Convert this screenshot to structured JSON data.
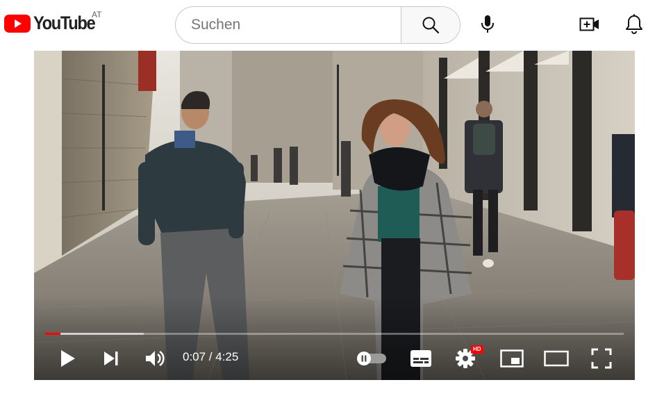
{
  "masthead": {
    "logo_text": "YouTube",
    "region_code": "AT",
    "search_placeholder": "Suchen",
    "search_value": "",
    "icons": [
      "search-icon",
      "mic-icon",
      "create-video-icon",
      "notifications-bell-icon"
    ]
  },
  "player": {
    "current_time": "0:07",
    "duration": "4:25",
    "time_display": "0:07 / 4:25",
    "progress_fraction": 0.027,
    "buffered_fraction": 0.17,
    "quality_badge": "HD",
    "autoplay_on": false,
    "colors": {
      "played": "#ff0000",
      "logo": "#ff0000",
      "badge": "#ff0000"
    },
    "icons": [
      "play-icon",
      "next-icon",
      "volume-icon",
      "autoplay-toggle",
      "subtitles-icon",
      "settings-gear-icon",
      "miniplayer-icon",
      "theater-mode-icon",
      "fullscreen-icon"
    ]
  }
}
